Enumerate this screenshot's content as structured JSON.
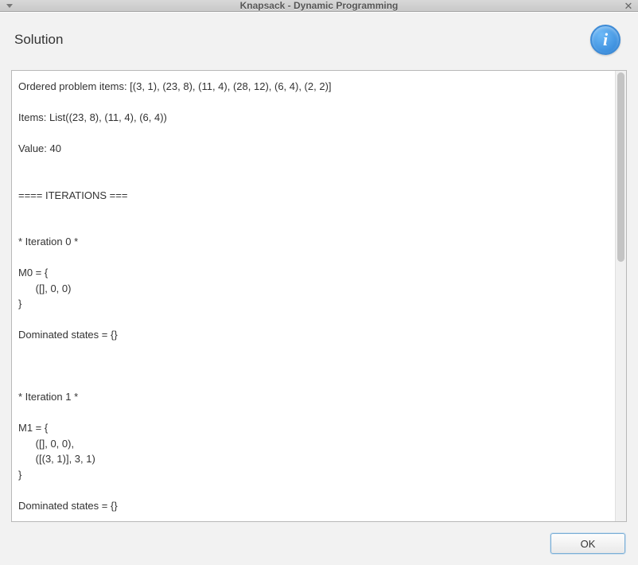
{
  "window": {
    "title": "Knapsack - Dynamic Programming"
  },
  "dialog": {
    "header": "Solution",
    "ok_label": "OK"
  },
  "content": {
    "text": "Ordered problem items: [(3, 1), (23, 8), (11, 4), (28, 12), (6, 4), (2, 2)]\n\nItems: List((23, 8), (11, 4), (6, 4))\n\nValue: 40\n\n\n==== ITERATIONS ===\n\n\n* Iteration 0 *\n\nM0 = {\n      ([], 0, 0)\n}\n\nDominated states = {}\n\n\n\n* Iteration 1 *\n\nM1 = {\n      ([], 0, 0),\n      ([(3, 1)], 3, 1)\n}\n\nDominated states = {}"
  }
}
